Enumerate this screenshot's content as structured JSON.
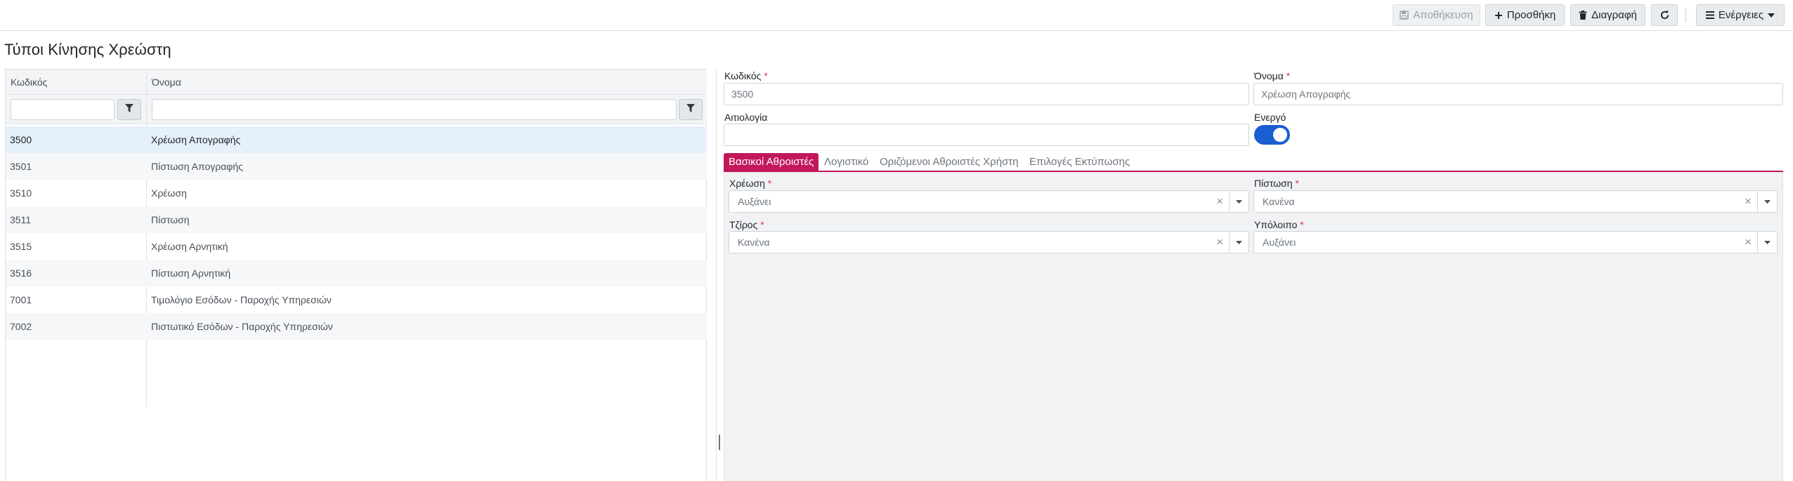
{
  "toolbar": {
    "save_label": "Αποθήκευση",
    "add_label": "Προσθήκη",
    "delete_label": "Διαγραφή",
    "actions_label": "Ενέργειες"
  },
  "page": {
    "title": "Τύποι Κίνησης Χρεώστη"
  },
  "grid": {
    "columns": [
      "Κωδικός",
      "Όνομα"
    ],
    "rows": [
      {
        "code": "3500",
        "name": "Χρέωση Απογραφής"
      },
      {
        "code": "3501",
        "name": "Πίστωση Απογραφής"
      },
      {
        "code": "3510",
        "name": "Χρέωση"
      },
      {
        "code": "3511",
        "name": "Πίστωση"
      },
      {
        "code": "3515",
        "name": "Χρέωση Αρνητική"
      },
      {
        "code": "3516",
        "name": "Πίστωση Αρνητική"
      },
      {
        "code": "7001",
        "name": "Τιμολόγιο Εσόδων - Παροχής Υπηρεσιών"
      },
      {
        "code": "7002",
        "name": "Πιστωτικό Εσόδων - Παροχής Υπηρεσιών"
      }
    ]
  },
  "form": {
    "code": {
      "label": "Κωδικός",
      "value": "3500"
    },
    "name": {
      "label": "Όνομα",
      "value": "Χρέωση Απογραφής"
    },
    "reason": {
      "label": "Αιτιολογία",
      "value": ""
    },
    "active": {
      "label": "Ενεργό",
      "checked": true
    },
    "required_mark": "*"
  },
  "tabs": [
    "Βασικοί Αθροιστές",
    "Λογιστικό",
    "Οριζόμενοι Αθροιστές Χρήστη",
    "Επιλογές Εκτύπωσης"
  ],
  "totals": {
    "debit": {
      "label": "Χρέωση",
      "value": "Αυξάνει"
    },
    "credit": {
      "label": "Πίστωση",
      "value": "Κανένα"
    },
    "turnover": {
      "label": "Τζίρος",
      "value": "Κανένα"
    },
    "balance": {
      "label": "Υπόλοιπο",
      "value": "Αυξάνει"
    },
    "clear_symbol": "×"
  },
  "colors": {
    "accent": "#c2185b",
    "toggle": "#1a5fd1",
    "selected_row": "#e6f0fb",
    "required": "#dc3545"
  }
}
